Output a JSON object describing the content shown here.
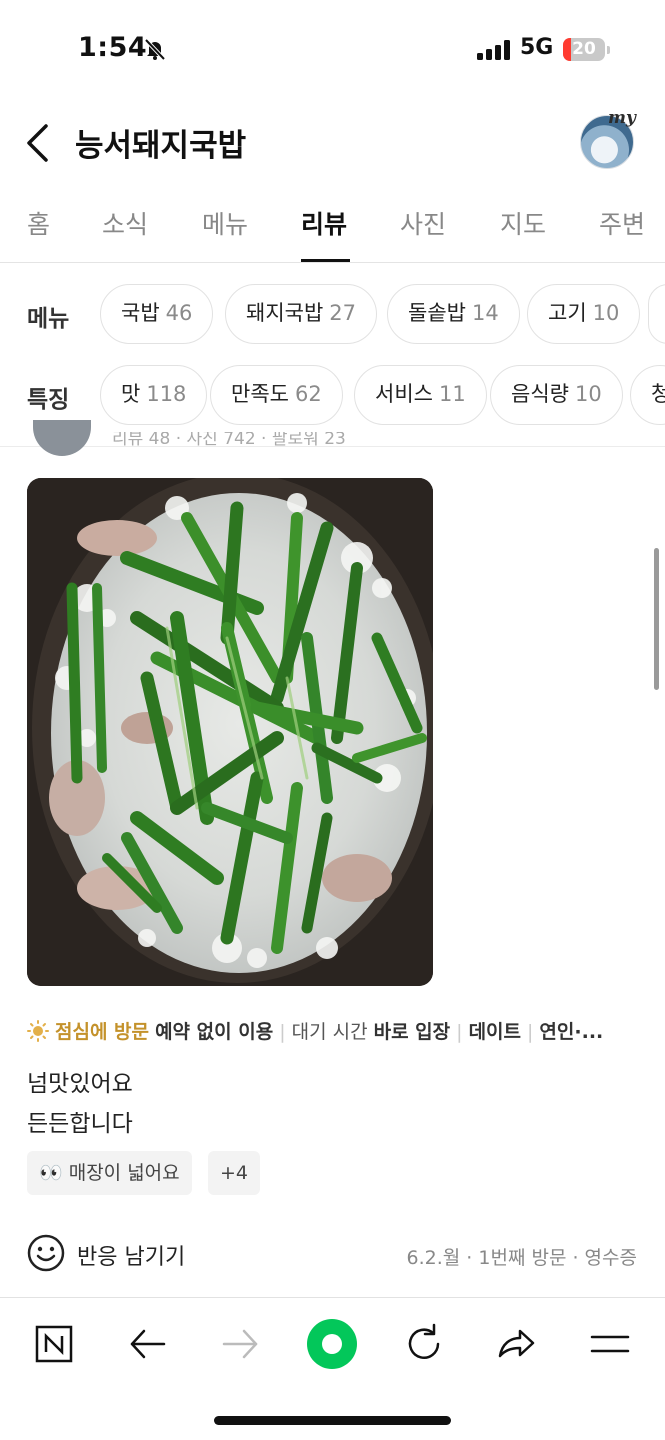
{
  "status_bar": {
    "time": "1:54",
    "network": "5G",
    "battery": "20",
    "battery_level": 0.2
  },
  "header": {
    "title": "능서돼지국밥",
    "avatar_badge": "my"
  },
  "tabs": [
    {
      "label": "홈",
      "active": false
    },
    {
      "label": "소식",
      "active": false
    },
    {
      "label": "메뉴",
      "active": false
    },
    {
      "label": "리뷰",
      "active": true
    },
    {
      "label": "사진",
      "active": false
    },
    {
      "label": "지도",
      "active": false
    },
    {
      "label": "주변",
      "active": false
    }
  ],
  "filters": {
    "menu": {
      "label": "메뉴",
      "chips": [
        {
          "name": "국밥",
          "count": "46"
        },
        {
          "name": "돼지국밥",
          "count": "27"
        },
        {
          "name": "돌솥밥",
          "count": "14"
        },
        {
          "name": "고기",
          "count": "10"
        }
      ]
    },
    "feature": {
      "label": "특징",
      "chips": [
        {
          "name": "맛",
          "count": "118"
        },
        {
          "name": "만족도",
          "count": "62"
        },
        {
          "name": "서비스",
          "count": "11"
        },
        {
          "name": "음식량",
          "count": "10"
        },
        {
          "name": "청",
          "count": ""
        }
      ]
    }
  },
  "review": {
    "meta_partial": "리뷰 48 · 사진 742 · 팔로워 23",
    "visit_tags": {
      "meal_time": "점심에 방문",
      "reservation": "예약 없이 이용",
      "wait_label": "대기 시간",
      "wait_value": "바로 입장",
      "purpose": "데이트",
      "companion": "연인·..."
    },
    "text_lines": [
      "넘맛있어요",
      "든든합니다"
    ],
    "keyword": "매장이 넓어요",
    "keyword_emoji": "👀",
    "more_keywords": "+4",
    "react_label": "반응 남기기",
    "visit_info": "6.2.월 · 1번째 방문 · 영수증"
  },
  "colors": {
    "accent_green": "#03c75a",
    "meal_gold": "#c4922b",
    "battery_red": "#ff3b30"
  },
  "bottom_nav": [
    "naver-home-icon",
    "back-arrow-icon",
    "forward-arrow-icon",
    "green-dot-icon",
    "refresh-icon",
    "share-icon",
    "menu-icon"
  ]
}
